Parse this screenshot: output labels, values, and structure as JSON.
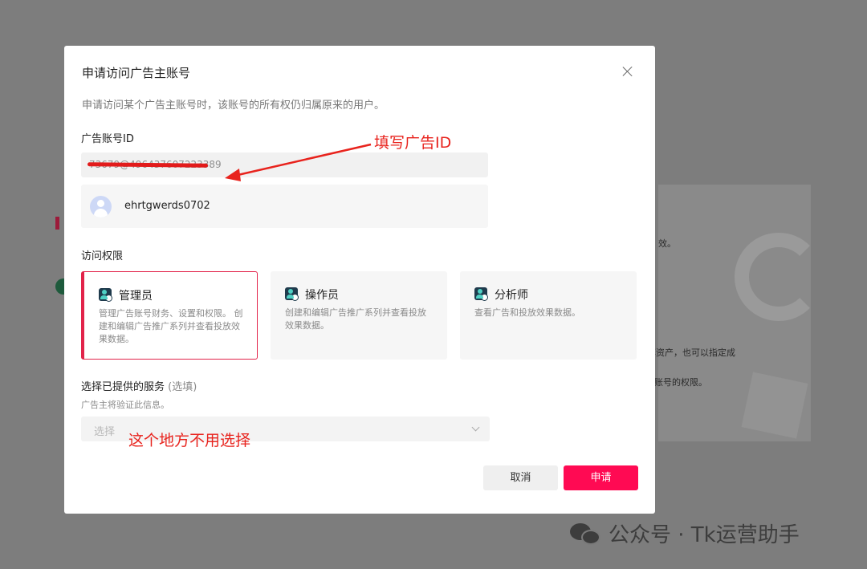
{
  "modal": {
    "title": "申请访问广告主账号",
    "description": "申请访问某个广告主账号时，该账号的所有权仍归属原来的用户。"
  },
  "account_id": {
    "label": "广告账号ID",
    "value": "73679@496437607223389"
  },
  "account_result": {
    "name": "ehrtgwerds0702"
  },
  "permissions": {
    "label": "访问权限",
    "roles": [
      {
        "name": "管理员",
        "desc": "管理广告账号财务、设置和权限。 创建和编辑广告推广系列并查看投放效果数据。",
        "selected": true
      },
      {
        "name": "操作员",
        "desc": "创建和编辑广告推广系列并查看投放效果数据。",
        "selected": false
      },
      {
        "name": "分析师",
        "desc": "查看广告和投放效果数据。",
        "selected": false
      }
    ]
  },
  "service": {
    "label": "选择已提供的服务",
    "optional": "(选填)",
    "hint": "广告主将验证此信息。",
    "placeholder": "选择"
  },
  "buttons": {
    "cancel": "取消",
    "submit": "申请"
  },
  "annotations": {
    "fill_id": "填写广告ID",
    "no_select": "这个地方不用选择"
  },
  "background_text": {
    "t1": "效。",
    "t2": "享资产，也可以指定成",
    "t3": "账号的权限。"
  },
  "watermark": "公众号 · Tk运营助手",
  "colors": {
    "accent": "#ff0a53",
    "annotation": "#e8231d"
  }
}
